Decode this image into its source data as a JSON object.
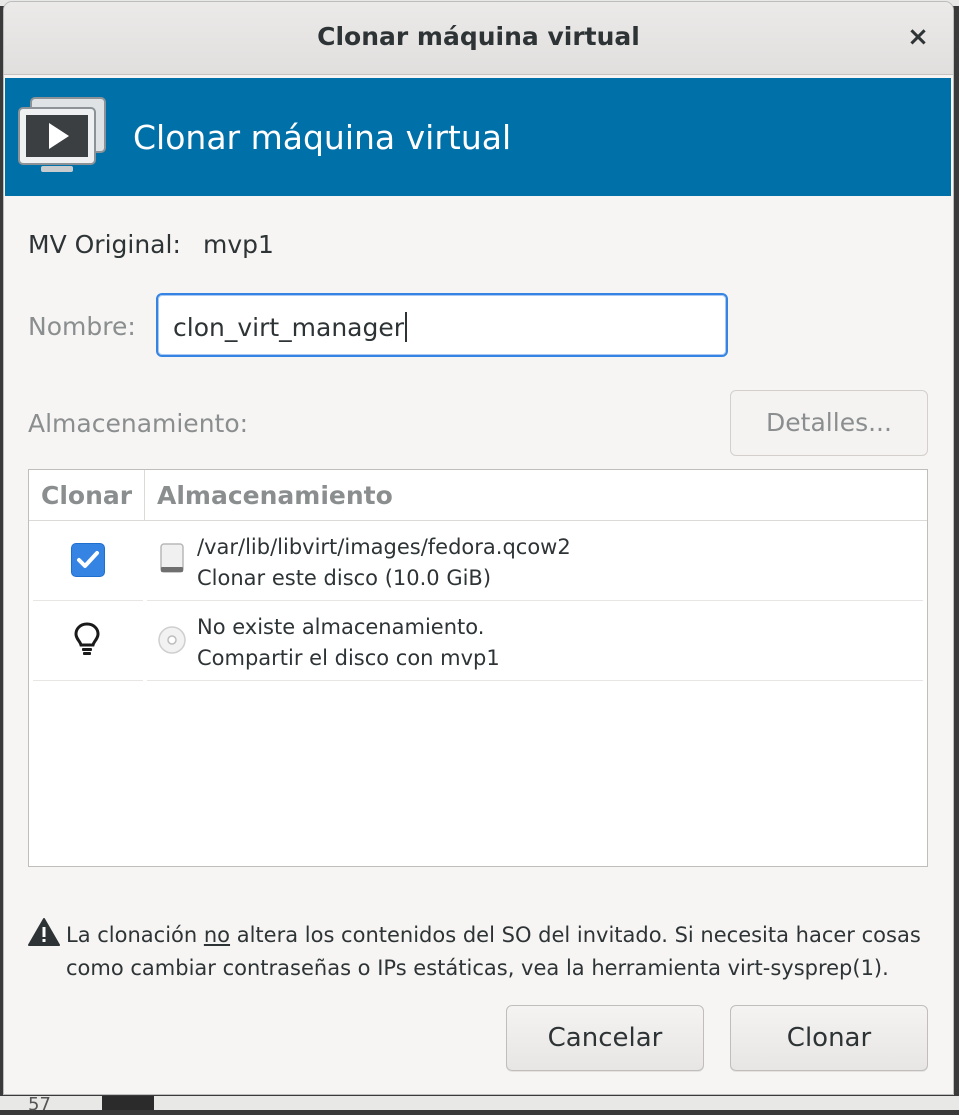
{
  "window": {
    "title": "Clonar máquina virtual",
    "close_glyph": "×"
  },
  "banner": {
    "title": "Clonar máquina virtual",
    "icon": "vm-console-icon",
    "background": "#0070a8"
  },
  "original": {
    "label": "MV Original:",
    "value": "mvp1"
  },
  "name": {
    "label": "Nombre:",
    "value": "clon_virt_manager"
  },
  "storage": {
    "label": "Almacenamiento:",
    "details_button": "Detalles..."
  },
  "table": {
    "columns": [
      "Clonar",
      "Almacenamiento"
    ],
    "rows": [
      {
        "clone_control": "checkbox",
        "checked": true,
        "icon": "hard-disk-icon",
        "line1": "/var/lib/libvirt/images/fedora.qcow2",
        "line2": "Clonar este disco (10.0 GiB)"
      },
      {
        "clone_control": "info-bulb",
        "checked": false,
        "icon": "cdrom-icon",
        "line1": "No existe almacenamiento.",
        "line2": "Compartir el disco con mvp1"
      }
    ]
  },
  "warning": {
    "pre": "La clonación ",
    "emph": "no",
    "post": " altera los contenidos del SO del invitado. Si necesita hacer cosas",
    "line2": "como cambiar contraseñas o IPs estáticas, vea la herramienta virt-sysprep(1)."
  },
  "buttons": {
    "cancel": "Cancelar",
    "clone": "Clonar"
  },
  "background": {
    "bottom_number": "57"
  },
  "colors": {
    "accent": "#3584e4",
    "banner": "#0070a8"
  }
}
